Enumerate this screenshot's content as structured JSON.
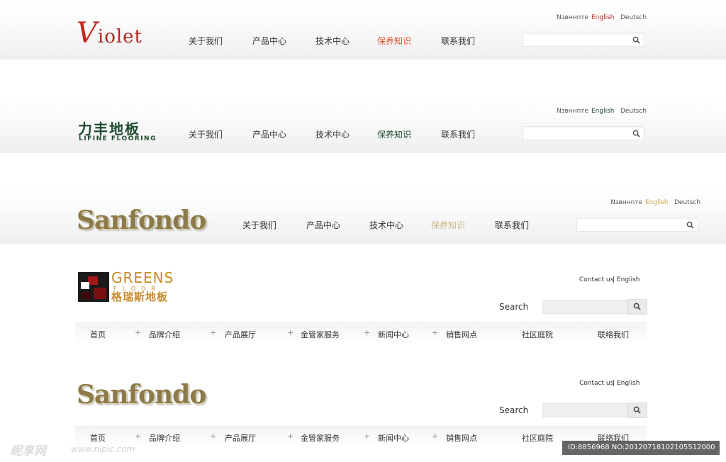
{
  "header1": {
    "brand": {
      "initial": "V",
      "rest": "iolet"
    },
    "nav": [
      "关于我们",
      "产品中心",
      "技术中心",
      "保养知识",
      "联系我们"
    ],
    "active_color": "#e0502a",
    "lang": [
      "Nзвннnте",
      "English",
      "Deutsch"
    ],
    "lang_active_color": "#b3261e"
  },
  "header2": {
    "brand_cn": "力丰地板",
    "brand_en": "LIFINE FLOORING",
    "nav": [
      "关于我们",
      "产品中心",
      "技术中心",
      "保养知识",
      "联系我们"
    ],
    "active_color": "#1f4a2f",
    "lang": [
      "Nзвннnте",
      "English",
      "Deutsch"
    ],
    "lang_active_color": "#1f4a2f"
  },
  "header3": {
    "brand": "Sanfondo",
    "nav": [
      "关于我们",
      "产品中心",
      "技术中心",
      "保养知识",
      "联系我们"
    ],
    "active_color": "#c7b98a",
    "lang": [
      "Nзвннnте",
      "English",
      "Deutsch"
    ],
    "lang_active_color": "#c4a84a"
  },
  "header4": {
    "brand_en": "GREENS",
    "brand_sub": "FLOOR",
    "brand_cn": "格瑞斯地板",
    "contact": "Contact us",
    "sep": "|",
    "english": "English",
    "search_label": "Search",
    "nav": [
      "首页",
      "品牌介绍",
      "产品展厅",
      "金管家服务",
      "新闻中心",
      "销售网点",
      "社区庭院",
      "联络我们"
    ]
  },
  "header5": {
    "brand": "Sanfondo",
    "contact": "Contact us",
    "sep": "|",
    "english": "English",
    "search_label": "Search",
    "nav": [
      "首页",
      "品牌介绍",
      "产品展厅",
      "金管家服务",
      "新闻中心",
      "销售网点",
      "社区庭院",
      "联络我们"
    ]
  },
  "watermark": {
    "logo": "昵享网",
    "url": "www.nipic.com",
    "id": "ID:8856968 NO:20120718102105512000"
  }
}
